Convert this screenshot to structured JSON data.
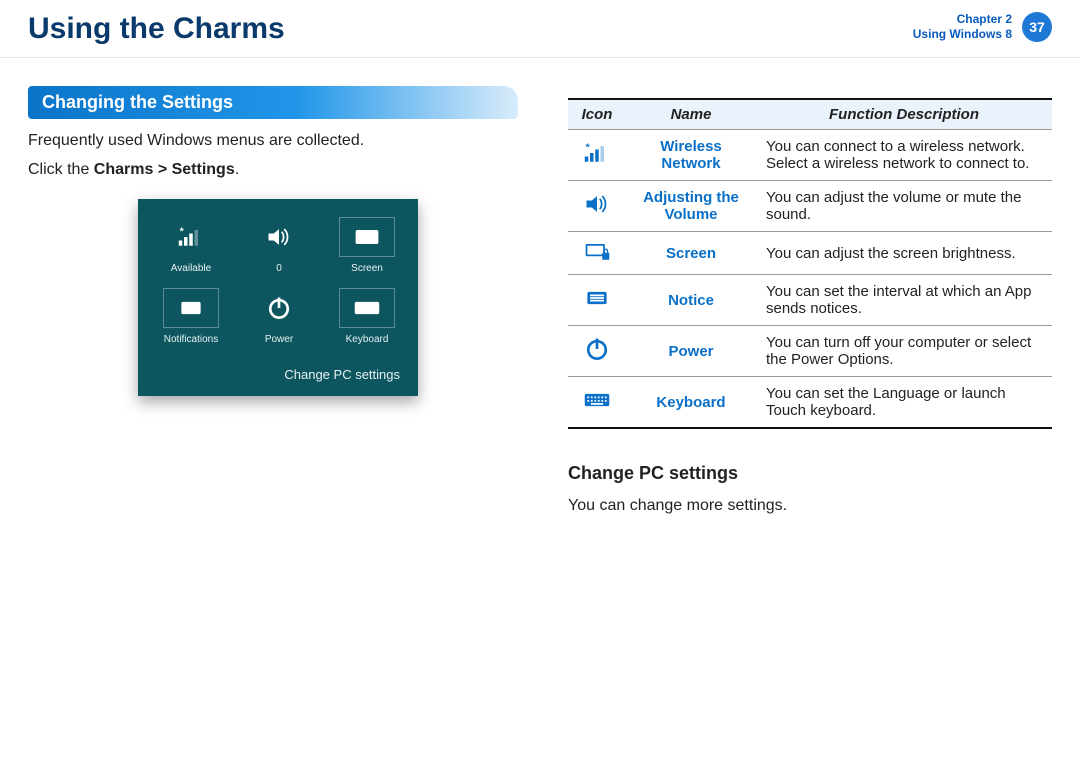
{
  "header": {
    "title": "Using the Charms",
    "chapter_line1": "Chapter 2",
    "chapter_line2": "Using Windows 8",
    "page_number": "37"
  },
  "section": {
    "ribbon": "Changing the Settings",
    "p1": "Frequently used Windows menus are collected.",
    "p2_prefix": "Click the ",
    "p2_bold": "Charms > Settings",
    "p2_suffix": "."
  },
  "charms_panel": {
    "tiles": [
      {
        "id": "available",
        "label": "Available"
      },
      {
        "id": "volume",
        "label": "0"
      },
      {
        "id": "screen",
        "label": "Screen"
      },
      {
        "id": "notifications",
        "label": "Notifications"
      },
      {
        "id": "power",
        "label": "Power"
      },
      {
        "id": "keyboard",
        "label": "Keyboard"
      }
    ],
    "footer": "Change PC settings"
  },
  "table": {
    "headers": {
      "icon": "Icon",
      "name": "Name",
      "desc": "Function Description"
    },
    "rows": [
      {
        "icon": "wireless",
        "name": "Wireless Network",
        "desc": "You can connect to a wireless network. Select a wireless network to connect to."
      },
      {
        "icon": "volume",
        "name": "Adjusting the Volume",
        "desc": "You can adjust the volume or mute the sound."
      },
      {
        "icon": "screen",
        "name": "Screen",
        "desc": "You can adjust the screen brightness."
      },
      {
        "icon": "notice",
        "name": "Notice",
        "desc": "You can set the interval at which an App sends notices."
      },
      {
        "icon": "power",
        "name": "Power",
        "desc": "You can turn off your computer or select the Power Options."
      },
      {
        "icon": "keyboard",
        "name": "Keyboard",
        "desc": "You can set the Language or launch Touch keyboard."
      }
    ]
  },
  "subsection": {
    "title": "Change PC settings",
    "text": "You can change more settings."
  }
}
